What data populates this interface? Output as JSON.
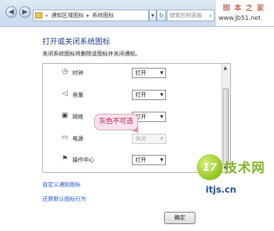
{
  "address_bar": {
    "back_glyph": "◀",
    "forward_glyph": "▶",
    "crumb_prefix": "«",
    "crumb_1": "通知区域图标",
    "crumb_sep": "▸",
    "crumb_2": "系统图标",
    "dropdown_glyph": "▾",
    "refresh_glyph": "↻",
    "search_placeholder": "搜索控制面板",
    "search_icon": "search-icon"
  },
  "watermark_top": {
    "text": "脚 本 之 家",
    "url": "www.Jb51.net"
  },
  "page": {
    "title": "打开或关闭系统图标",
    "description": "关闭系统图标将删除该图标并关闭通知。"
  },
  "icons": [
    {
      "label": "时钟",
      "glyph": "◷",
      "icon": "clock-icon",
      "value": "打开",
      "enabled": true
    },
    {
      "label": "音量",
      "glyph": "◁",
      "icon": "speaker-icon",
      "value": "打开",
      "enabled": true
    },
    {
      "label": "网络",
      "glyph": "▣",
      "icon": "network-icon",
      "value": "打开",
      "enabled": true
    },
    {
      "label": "电源",
      "glyph": "▭",
      "icon": "battery-icon",
      "value": "关闭",
      "enabled": false
    },
    {
      "label": "操作中心",
      "glyph": "⚑",
      "icon": "flag-icon",
      "value": "打开",
      "enabled": true
    }
  ],
  "callout": "灰色不可选",
  "links": {
    "customize": "自定义通知图标",
    "restore": "还原默认图标行为"
  },
  "ok_button": "确定",
  "watermark_bottom": {
    "logo_mark": "17",
    "name": "技术网",
    "url": "itjs.cn"
  }
}
